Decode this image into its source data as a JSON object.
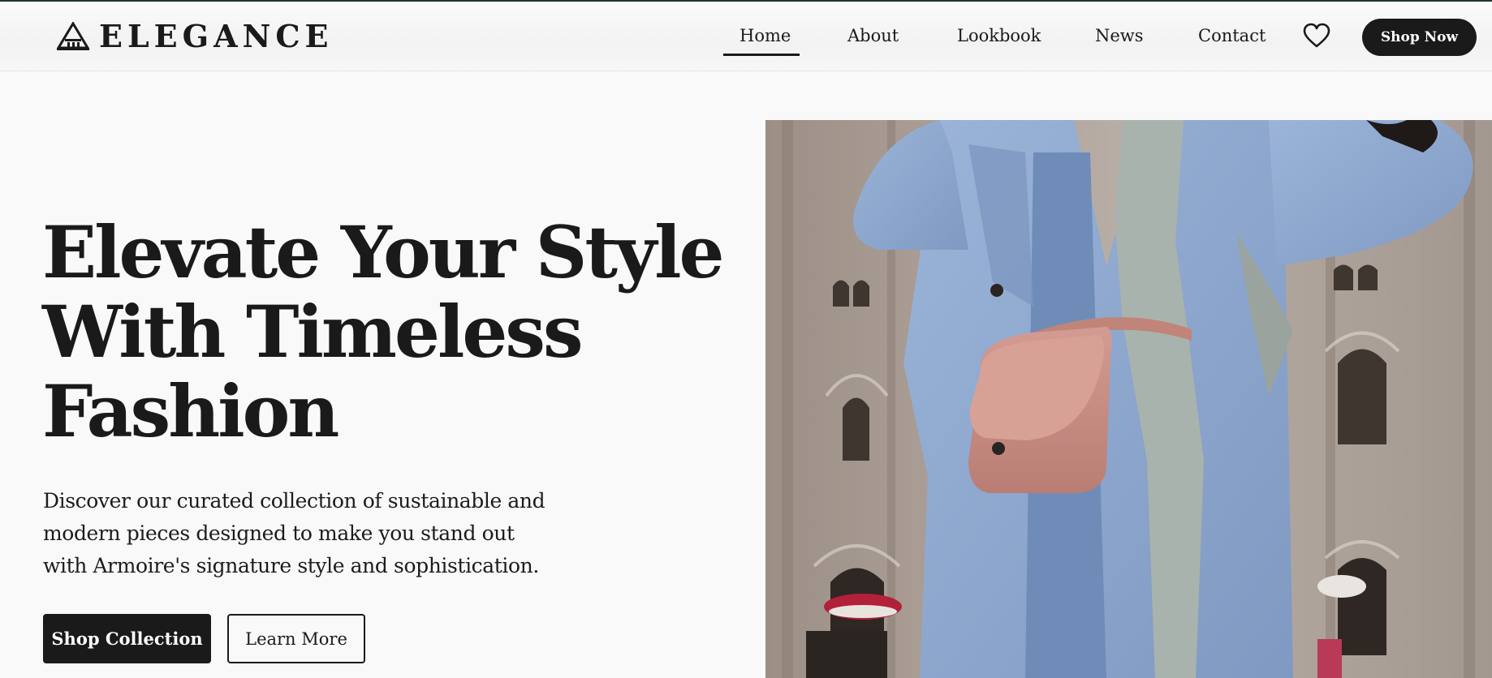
{
  "brand": {
    "name": "ELEGANCE",
    "logo_icon": "triangle-temple-icon"
  },
  "nav": {
    "items": [
      {
        "label": "Home",
        "active": true
      },
      {
        "label": "About",
        "active": false
      },
      {
        "label": "Lookbook",
        "active": false
      },
      {
        "label": "News",
        "active": false
      },
      {
        "label": "Contact",
        "active": false
      }
    ],
    "wishlist_icon": "heart-icon",
    "cta_label": "Shop Now"
  },
  "hero": {
    "title_lines": [
      "Elevate Your Style",
      "With Timeless",
      "Fashion"
    ],
    "description": "Discover our curated collection of sustainable and modern pieces designed to make you stand out with Armoire's signature style and sophistication.",
    "primary_button": "Shop Collection",
    "secondary_button": "Learn More"
  },
  "colors": {
    "accent": "#1a1a1a",
    "background": "#f9f9f9",
    "coat": "#8fa9cf",
    "bag": "#c98e84"
  }
}
